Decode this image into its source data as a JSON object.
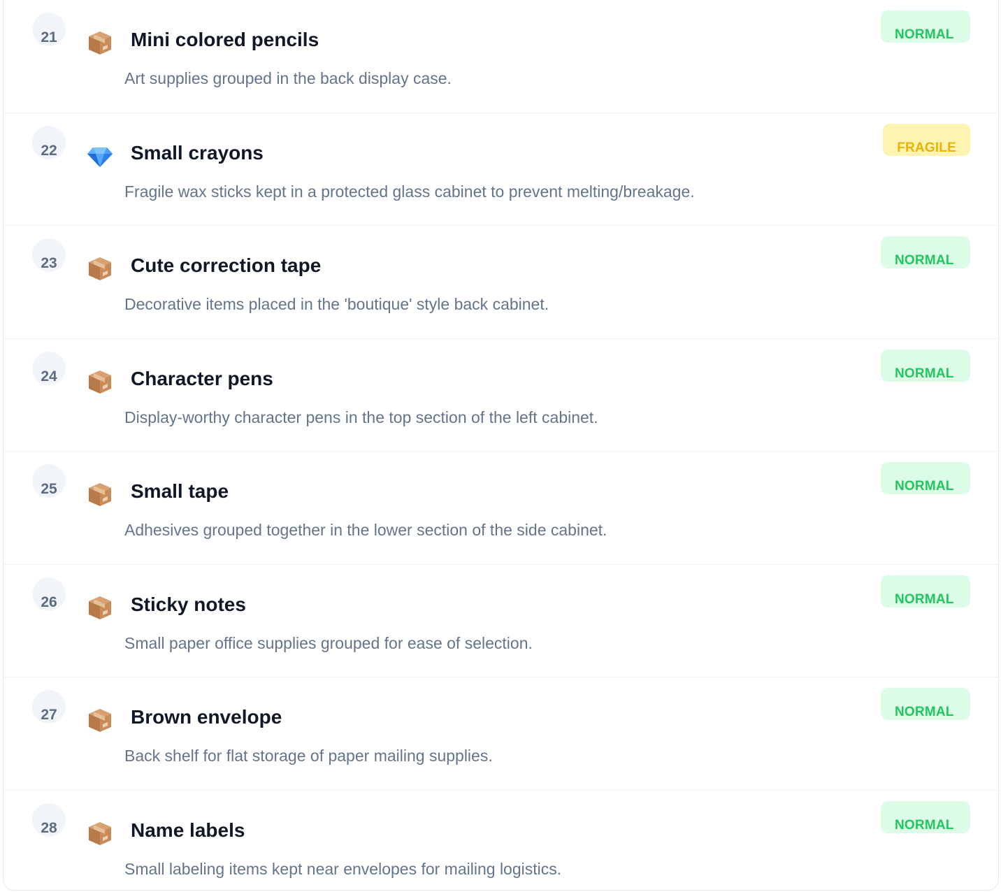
{
  "items": [
    {
      "number": "21",
      "icon": "box-icon",
      "title": "Mini colored pencils",
      "description": "Art supplies grouped in the back display case.",
      "tag": "NORMAL",
      "tag_type": "normal"
    },
    {
      "number": "22",
      "icon": "gem-icon",
      "title": "Small crayons",
      "description": "Fragile wax sticks kept in a protected glass cabinet to prevent melting/breakage.",
      "tag": "FRAGILE",
      "tag_type": "fragile"
    },
    {
      "number": "23",
      "icon": "box-icon",
      "title": "Cute correction tape",
      "description": "Decorative items placed in the 'boutique' style back cabinet.",
      "tag": "NORMAL",
      "tag_type": "normal"
    },
    {
      "number": "24",
      "icon": "box-icon",
      "title": "Character pens",
      "description": "Display-worthy character pens in the top section of the left cabinet.",
      "tag": "NORMAL",
      "tag_type": "normal"
    },
    {
      "number": "25",
      "icon": "box-icon",
      "title": "Small tape",
      "description": "Adhesives grouped together in the lower section of the side cabinet.",
      "tag": "NORMAL",
      "tag_type": "normal"
    },
    {
      "number": "26",
      "icon": "box-icon",
      "title": "Sticky notes",
      "description": "Small paper office supplies grouped for ease of selection.",
      "tag": "NORMAL",
      "tag_type": "normal"
    },
    {
      "number": "27",
      "icon": "box-icon",
      "title": "Brown envelope",
      "description": "Back shelf for flat storage of paper mailing supplies.",
      "tag": "NORMAL",
      "tag_type": "normal"
    },
    {
      "number": "28",
      "icon": "box-icon",
      "title": "Name labels",
      "description": "Small labeling items kept near envelopes for mailing logistics.",
      "tag": "NORMAL",
      "tag_type": "normal"
    }
  ],
  "colors": {
    "normal_bg": "#dcfce7",
    "normal_text": "#22c55e",
    "fragile_bg": "#fef3b0",
    "fragile_text": "#eab308"
  }
}
